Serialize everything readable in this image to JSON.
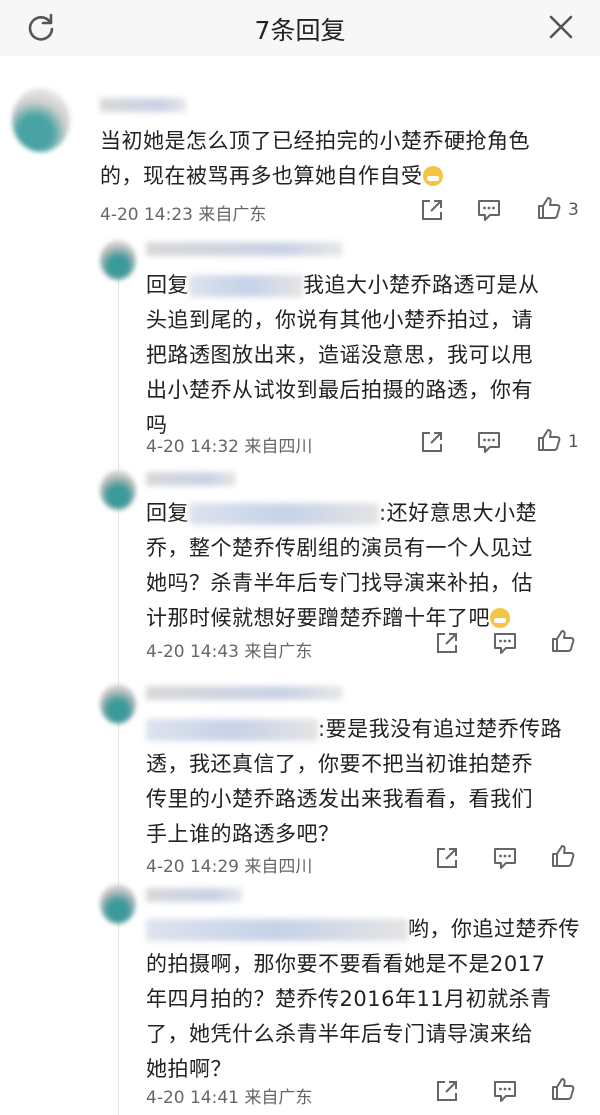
{
  "header": {
    "title": "7条回复"
  },
  "main_comment": {
    "text_line1": "当初她是怎么顶了已经拍完的小楚乔硬抢角色",
    "text_line2": "的，现在被骂再多也算她自作自受",
    "time": "4-20 14:23",
    "location": "来自广东",
    "like_count": "3"
  },
  "replies": [
    {
      "lines": [
        {
          "prefix": "回复",
          "text": "我追大小楚乔路透可是从"
        },
        {
          "text": "头追到尾的，你说有其他小楚乔拍过，请"
        },
        {
          "text": "把路透图放出来，造谣没意思，我可以甩"
        },
        {
          "text": "出小楚乔从试妆到最后拍摄的路透，你有"
        },
        {
          "text": "吗"
        }
      ],
      "time": "4-20 14:32",
      "location": "来自四川",
      "like_count": "1"
    },
    {
      "lines": [
        {
          "prefix": "回复",
          "text": ":还好意思大小楚"
        },
        {
          "text": "乔，整个楚乔传剧组的演员有一个人见过"
        },
        {
          "text": "她吗？杀青半年后专门找导演来补拍，估"
        },
        {
          "text": "计那时候就想好要蹭楚乔蹭十年了吧"
        }
      ],
      "time": "4-20 14:43",
      "location": "来自广东",
      "like_count": ""
    },
    {
      "lines": [
        {
          "text": ":要是我没有追过楚乔传路"
        },
        {
          "text": "透，我还真信了，你要不把当初谁拍楚乔"
        },
        {
          "text": "传里的小楚乔路透发出来我看看，看我们"
        },
        {
          "text": "手上谁的路透多吧？"
        }
      ],
      "time": "4-20 14:29",
      "location": "来自四川",
      "like_count": ""
    },
    {
      "lines": [
        {
          "text": "哟，你追过楚乔传"
        },
        {
          "text": "的拍摄啊，那你要不要看看她是不是2017"
        },
        {
          "text": "年四月拍的？楚乔传2016年11月初就杀青"
        },
        {
          "text": "了，她凭什么杀青半年后专门请导演来给"
        },
        {
          "text": "她拍啊？"
        }
      ],
      "time": "4-20 14:41",
      "location": "来自广东",
      "like_count": ""
    }
  ],
  "icons": {
    "refresh": "refresh-icon",
    "close": "close-icon",
    "share": "share-icon",
    "comment": "comment-icon",
    "like": "thumbs-up-icon",
    "emoji": "grimace-emoji"
  }
}
